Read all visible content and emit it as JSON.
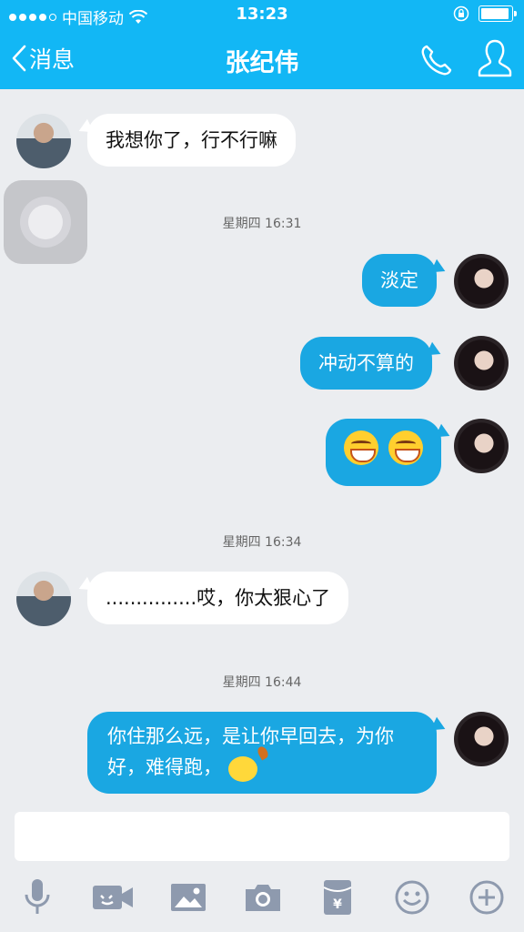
{
  "status_bar": {
    "carrier": "中国移动",
    "time": "13:23",
    "battery_level": 0.95
  },
  "nav": {
    "back_label": "消息",
    "title": "张纪伟",
    "icons": [
      "chevron-left-icon",
      "phone-icon",
      "profile-icon"
    ]
  },
  "messages": [
    {
      "side": "left",
      "text": "我想你了，行不行嘛"
    },
    {
      "timestamp": "星期四 16:31"
    },
    {
      "side": "right",
      "text": "淡定"
    },
    {
      "side": "right",
      "text": "冲动不算的"
    },
    {
      "side": "right",
      "emoji_count": 2,
      "emoji": "laughing-emoji"
    },
    {
      "timestamp": "星期四 16:34"
    },
    {
      "side": "left",
      "text": "...............哎，你太狠心了"
    },
    {
      "timestamp": "星期四 16:44"
    },
    {
      "side": "right",
      "text_line1": "你住那么远，是让你早回去，为你",
      "text_line2": "好，难得跑，"
    }
  ],
  "input": {
    "value": "",
    "placeholder": ""
  },
  "toolbar": {
    "icons": [
      "microphone-icon",
      "video-icon",
      "image-icon",
      "camera-icon",
      "red-packet-icon",
      "emoji-icon",
      "plus-icon"
    ]
  },
  "colors": {
    "header": "#12b7f5",
    "bubble_mine": "#1aa7e2",
    "bubble_theirs": "#ffffff",
    "background": "#ebedf0",
    "toolbar_icon": "#8e9aae"
  }
}
